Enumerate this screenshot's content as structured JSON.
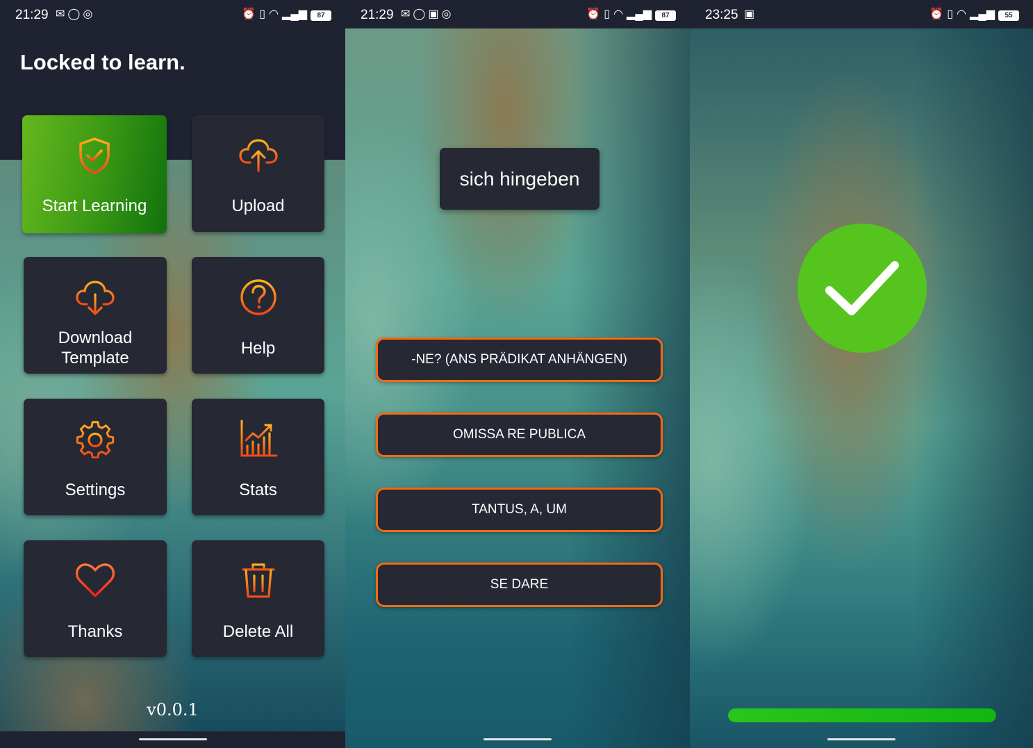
{
  "screen1": {
    "status": {
      "time": "21:29",
      "battery": "87"
    },
    "app_title": "Locked to learn.",
    "tiles": [
      {
        "label": "Start Learning",
        "icon": "shield-check-icon"
      },
      {
        "label": "Upload",
        "icon": "cloud-upload-icon"
      },
      {
        "label": "Download Template",
        "icon": "cloud-download-icon"
      },
      {
        "label": "Help",
        "icon": "help-circle-icon"
      },
      {
        "label": "Settings",
        "icon": "gear-icon"
      },
      {
        "label": "Stats",
        "icon": "chart-icon"
      },
      {
        "label": "Thanks",
        "icon": "heart-icon"
      },
      {
        "label": "Delete All",
        "icon": "trash-icon"
      }
    ],
    "version": "v0.0.1"
  },
  "screen2": {
    "status": {
      "time": "21:29",
      "battery": "87"
    },
    "word": "sich hingeben",
    "answers": [
      "-NE? (ANS PRÄDIKAT ANHÄNGEN)",
      "OMISSA RE PUBLICA",
      "TANTUS, A, UM",
      "SE DARE"
    ]
  },
  "screen3": {
    "status": {
      "time": "23:25",
      "battery": "55"
    },
    "result_icon": "checkmark-icon",
    "progress": 1.0
  },
  "colors": {
    "surface": "#262833",
    "header": "#1f2230",
    "accent_orange": "#f26a12",
    "success_green": "#55c41e",
    "progress_green": "#1dbd17"
  }
}
